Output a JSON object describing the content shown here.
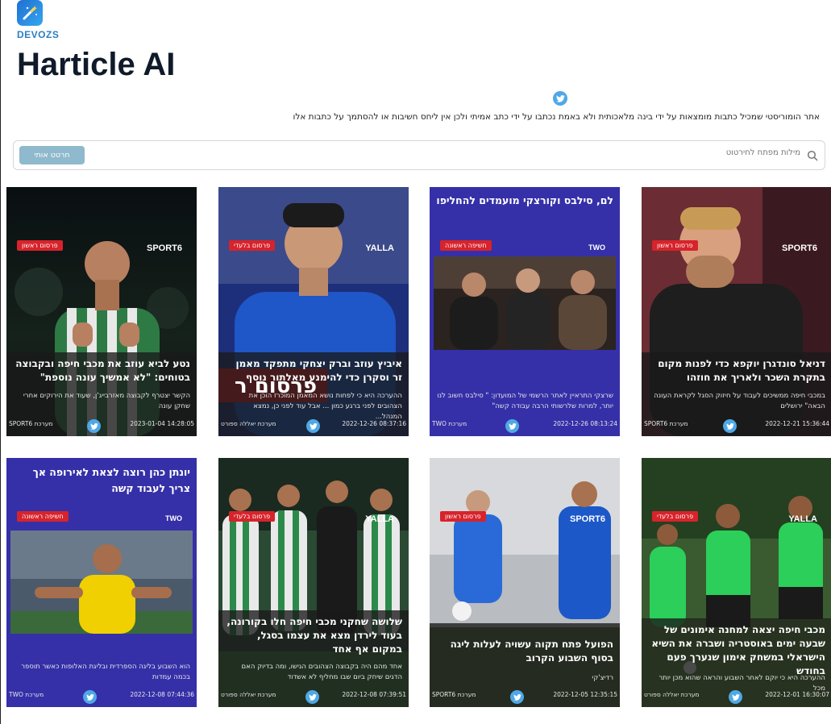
{
  "brand": "DEVOZS",
  "app_title": "Harticle AI",
  "disclaimer": "אתר הומוריסטי שמכיל כתבות מומצאות על ידי בינה מלאכותית ולא באמת נכתבו על ידי כתב אמיתי ולכן אין ליחס חשיבות או להסתמך על כתבות אלו",
  "search": {
    "placeholder": "מילות מפתח לחירטוט",
    "button": "חרטט אותי"
  },
  "colors": {
    "accent": "#4fa8e6",
    "badge": "#d7232b",
    "blue_card": "#3530a8"
  },
  "cards": [
    {
      "source": "SPORT6",
      "badge": "פרסום ראשון",
      "headline": "נטע לביא עוזב את מכבי חיפה ובקבוצה בטוחים: \"לא אמשיך עונה נוספת\"",
      "summary": "הקשר יצטרף לקבוצה מאזרבייג'ן, שעוד את הירוקים אחרי שחקן עונה",
      "date": "2023-01-04 14:28:05",
      "editor": "מערכת SPORT6"
    },
    {
      "source": "YALLA",
      "badge": "פרסום בלעדי",
      "headline": "איביץ עוזב וברק יצחקי מתפקד מאמן זר וסקרן כדי להימנע מאלתור נוסף",
      "summary": "ההערכה היא כי לפחות נושא המאמן המוכרז הוכן את הצהובים לפני ברגע כמון ... אבל עוד לפני כן, נמצא המנהל...",
      "date": "2022-12-26 08:37:16",
      "editor": "מערכת יאללה ספורט",
      "image_text": "פרסום ר"
    },
    {
      "source": "TWO",
      "badge": "חשיפה ראשונה",
      "headline": "לם, סילבס וקורצקי מועמדים להחליפו",
      "summary": "שרצקי התראיין לאתר הרשמי של המועדון: \" סילבס חשוב לנו יותר, למרות שלרשותי הרבה עבודה קשה\"",
      "date": "2022-12-26 08:13:24",
      "editor": "מערכת TWO"
    },
    {
      "source": "SPORT6",
      "badge": "פרסום ראשון",
      "headline": "דניאל סונדגרן יוקפא כדי לפנות מקום בתקרת השכר ולאריך את חוזהו",
      "summary": "במכבי חיפה ממשיכים לעבוד על חיזוק הסגל לקראת העונה הבאה\" ירושלים",
      "date": "2022-12-21 15:36:44",
      "editor": "מערכת SPORT6"
    },
    {
      "source": "TWO",
      "badge": "חשיפה ראשונה",
      "headline": "יונתן כהן רוצה לצאת לאירופה אך צריך לעבוד קשה",
      "summary": "הוא השבוע בליגה הספרדית ובליגת האלופות כאשר תוספר בכמה עמדות",
      "date": "2022-12-08 07:44:36",
      "editor": "מערכת TWO"
    },
    {
      "source": "YALLA",
      "badge": "פרסום בלעדי",
      "headline": "שלושה שחקני מכבי חיפה חלו בקורונה, בעוד לירדן מצא את עצמו בסגל, במקום אף אחד",
      "summary": "אחד מהם היה בקבוצה הצהובים הגישו, ומה בדיוק האם הדגים שיחק ביום שבו מחליף לא אשדוד",
      "date": "2022-12-08 07:39:51",
      "editor": "מערכת יאללה ספורט"
    },
    {
      "source": "SPORT6",
      "badge": "פרסום ראשון",
      "headline": "הפועל פתח תקוה עשויה לעלות ליגה בסוף השבוע הקרוב",
      "summary": "רדיצ'קי",
      "date": "2022-12-05 12:35:15",
      "editor": "מערכת SPORT6"
    },
    {
      "source": "YALLA",
      "badge": "פרסום בלעדי",
      "headline": "מכבי חיפה יצאה למחנה אימונים של שבעה ימים באוסטריה ושברה את השיא הישראלי במשחק אימון שנערך פעם בחודש",
      "summary": "ההערכה היא כי יוקם לאחר השבוע והראה שהוא מכן יותר מכל",
      "date": "2022-12-01 16:30:07",
      "editor": "מערכת יאללה ספורט"
    }
  ]
}
